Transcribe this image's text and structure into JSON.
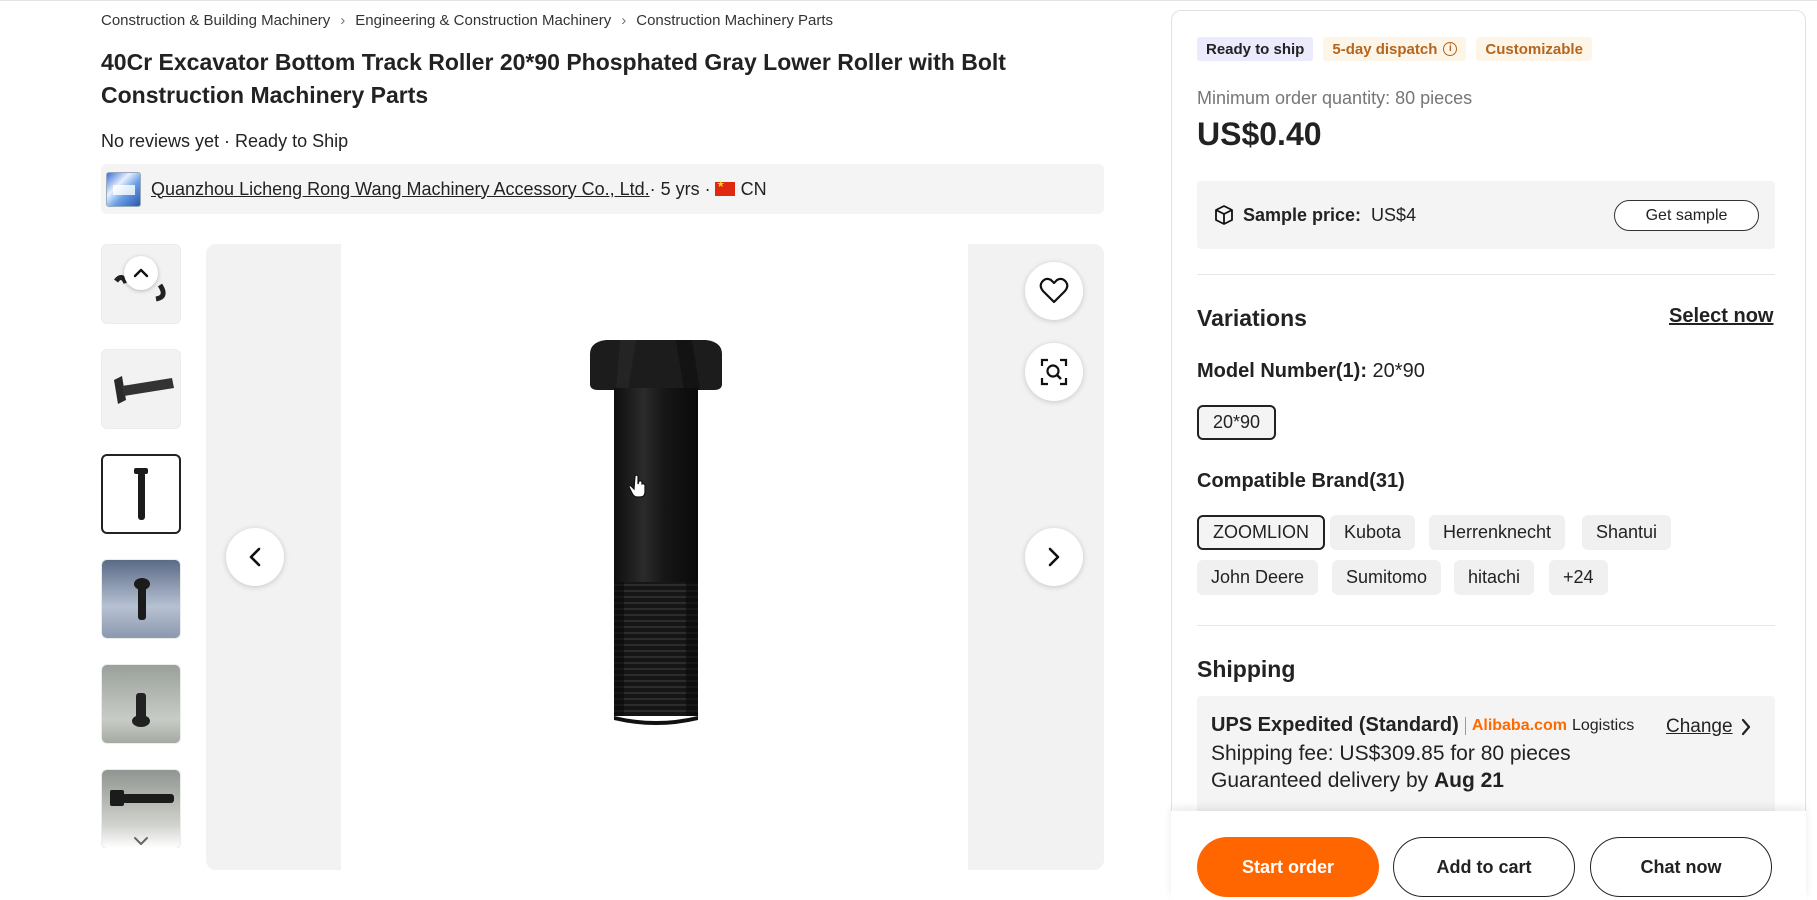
{
  "breadcrumb": [
    "Construction & Building Machinery",
    "Engineering & Construction Machinery",
    "Construction Machinery Parts"
  ],
  "product": {
    "title": "40Cr Excavator Bottom Track Roller 20*90 Phosphated Gray Lower Roller with Bolt Construction Machinery Parts",
    "reviews_line": "No reviews yet · Ready to Ship"
  },
  "supplier": {
    "name": "Quanzhou Licheng Rong Wang Machinery Accessory Co., Ltd.",
    "years": " · 5 yrs · ",
    "country": "CN"
  },
  "badges": {
    "ready": "Ready to ship",
    "dispatch": "5-day dispatch",
    "custom": "Customizable"
  },
  "pricing": {
    "moq": "Minimum order quantity: 80 pieces",
    "price": "US$0.40",
    "sample_label": "Sample price:",
    "sample_value": "US$4",
    "get_sample": "Get sample"
  },
  "variations": {
    "heading": "Variations",
    "select_now": "Select now",
    "model_label": "Model Number(1):",
    "model_value": " 20*90",
    "model_options": [
      "20*90"
    ],
    "brand_label": "Compatible Brand(31)",
    "brands_row1": [
      "ZOOMLION",
      "Kubota",
      "Herrenknecht",
      "Shantui"
    ],
    "brands_row2": [
      "John Deere",
      "Sumitomo",
      "hitachi",
      "+24"
    ]
  },
  "shipping": {
    "heading": "Shipping",
    "service": "UPS Expedited (Standard)",
    "provider_brand": "Alibaba.com",
    "provider_suffix": "Logistics",
    "change": "Change",
    "fee": "Shipping fee: US$309.85 for 80 pieces",
    "delivery_prefix": "Guaranteed delivery by ",
    "delivery_date": "Aug 21"
  },
  "actions": {
    "start_order": "Start order",
    "add_to_cart": "Add to cart",
    "chat_now": "Chat now"
  },
  "colors": {
    "accent": "#ff6600",
    "alibaba_orange": "#ff6a00",
    "dispatch_text": "#b5651d"
  }
}
